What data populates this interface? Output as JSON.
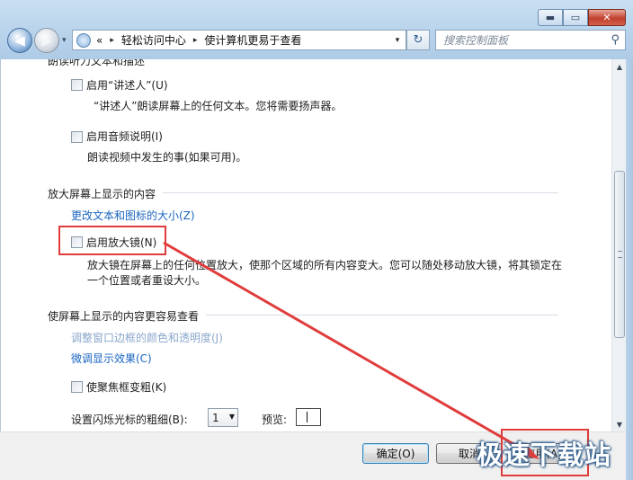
{
  "window": {
    "controls": {
      "minimize": "▬",
      "maximize": "▭",
      "close": "✕"
    }
  },
  "nav": {
    "back_icon": "back-arrow-icon",
    "forward_icon": "forward-arrow-icon",
    "history_dropdown": "▾"
  },
  "address": {
    "prefix": "«",
    "crumb1": "轻松访问中心",
    "sep": "▸",
    "crumb2": "使计算机更易于查看",
    "dropdown": "▾",
    "refresh": "↻"
  },
  "search": {
    "placeholder": "搜索控制面板",
    "icon": "⚲"
  },
  "sections": {
    "narrator_heading": "朗读听力文本和描述",
    "magnify_heading": "放大屏幕上显示的内容",
    "easier_heading": "使屏幕上显示的内容更容易查看"
  },
  "options": {
    "narrator_label": "启用“讲述人”(U)",
    "narrator_desc": "“讲述人”朗读屏幕上的任何文本。您将需要扬声器。",
    "audio_desc_label": "启用音频说明(I)",
    "audio_desc_desc": "朗读视频中发生的事(如果可用)。",
    "text_size_link": "更改文本和图标的大小(Z)",
    "magnifier_label": "启用放大镜(N)",
    "magnifier_desc_line1": "放大镜在屏幕上的任何位置放大，使那个区域的所有内容变大。您可以随处移动放大镜，将其锁定在",
    "magnifier_desc_line2": "一个位置或者重设大小。",
    "window_border_link": "调整窗口边框的颜色和透明度(J)",
    "fine_tune_link": "微调显示效果(C)",
    "focus_label": "使聚焦框变粗(K)",
    "cursor_thickness_label": "设置闪烁光标的粗细(B):",
    "cursor_thickness_value": "1",
    "preview_label": "预览:"
  },
  "buttons": {
    "ok": "确定(O)",
    "cancel": "取消",
    "apply": "应用(A)"
  },
  "watermark": "极速下载站",
  "colors": {
    "highlight": "#e03c3c",
    "link": "#1a65c0"
  }
}
